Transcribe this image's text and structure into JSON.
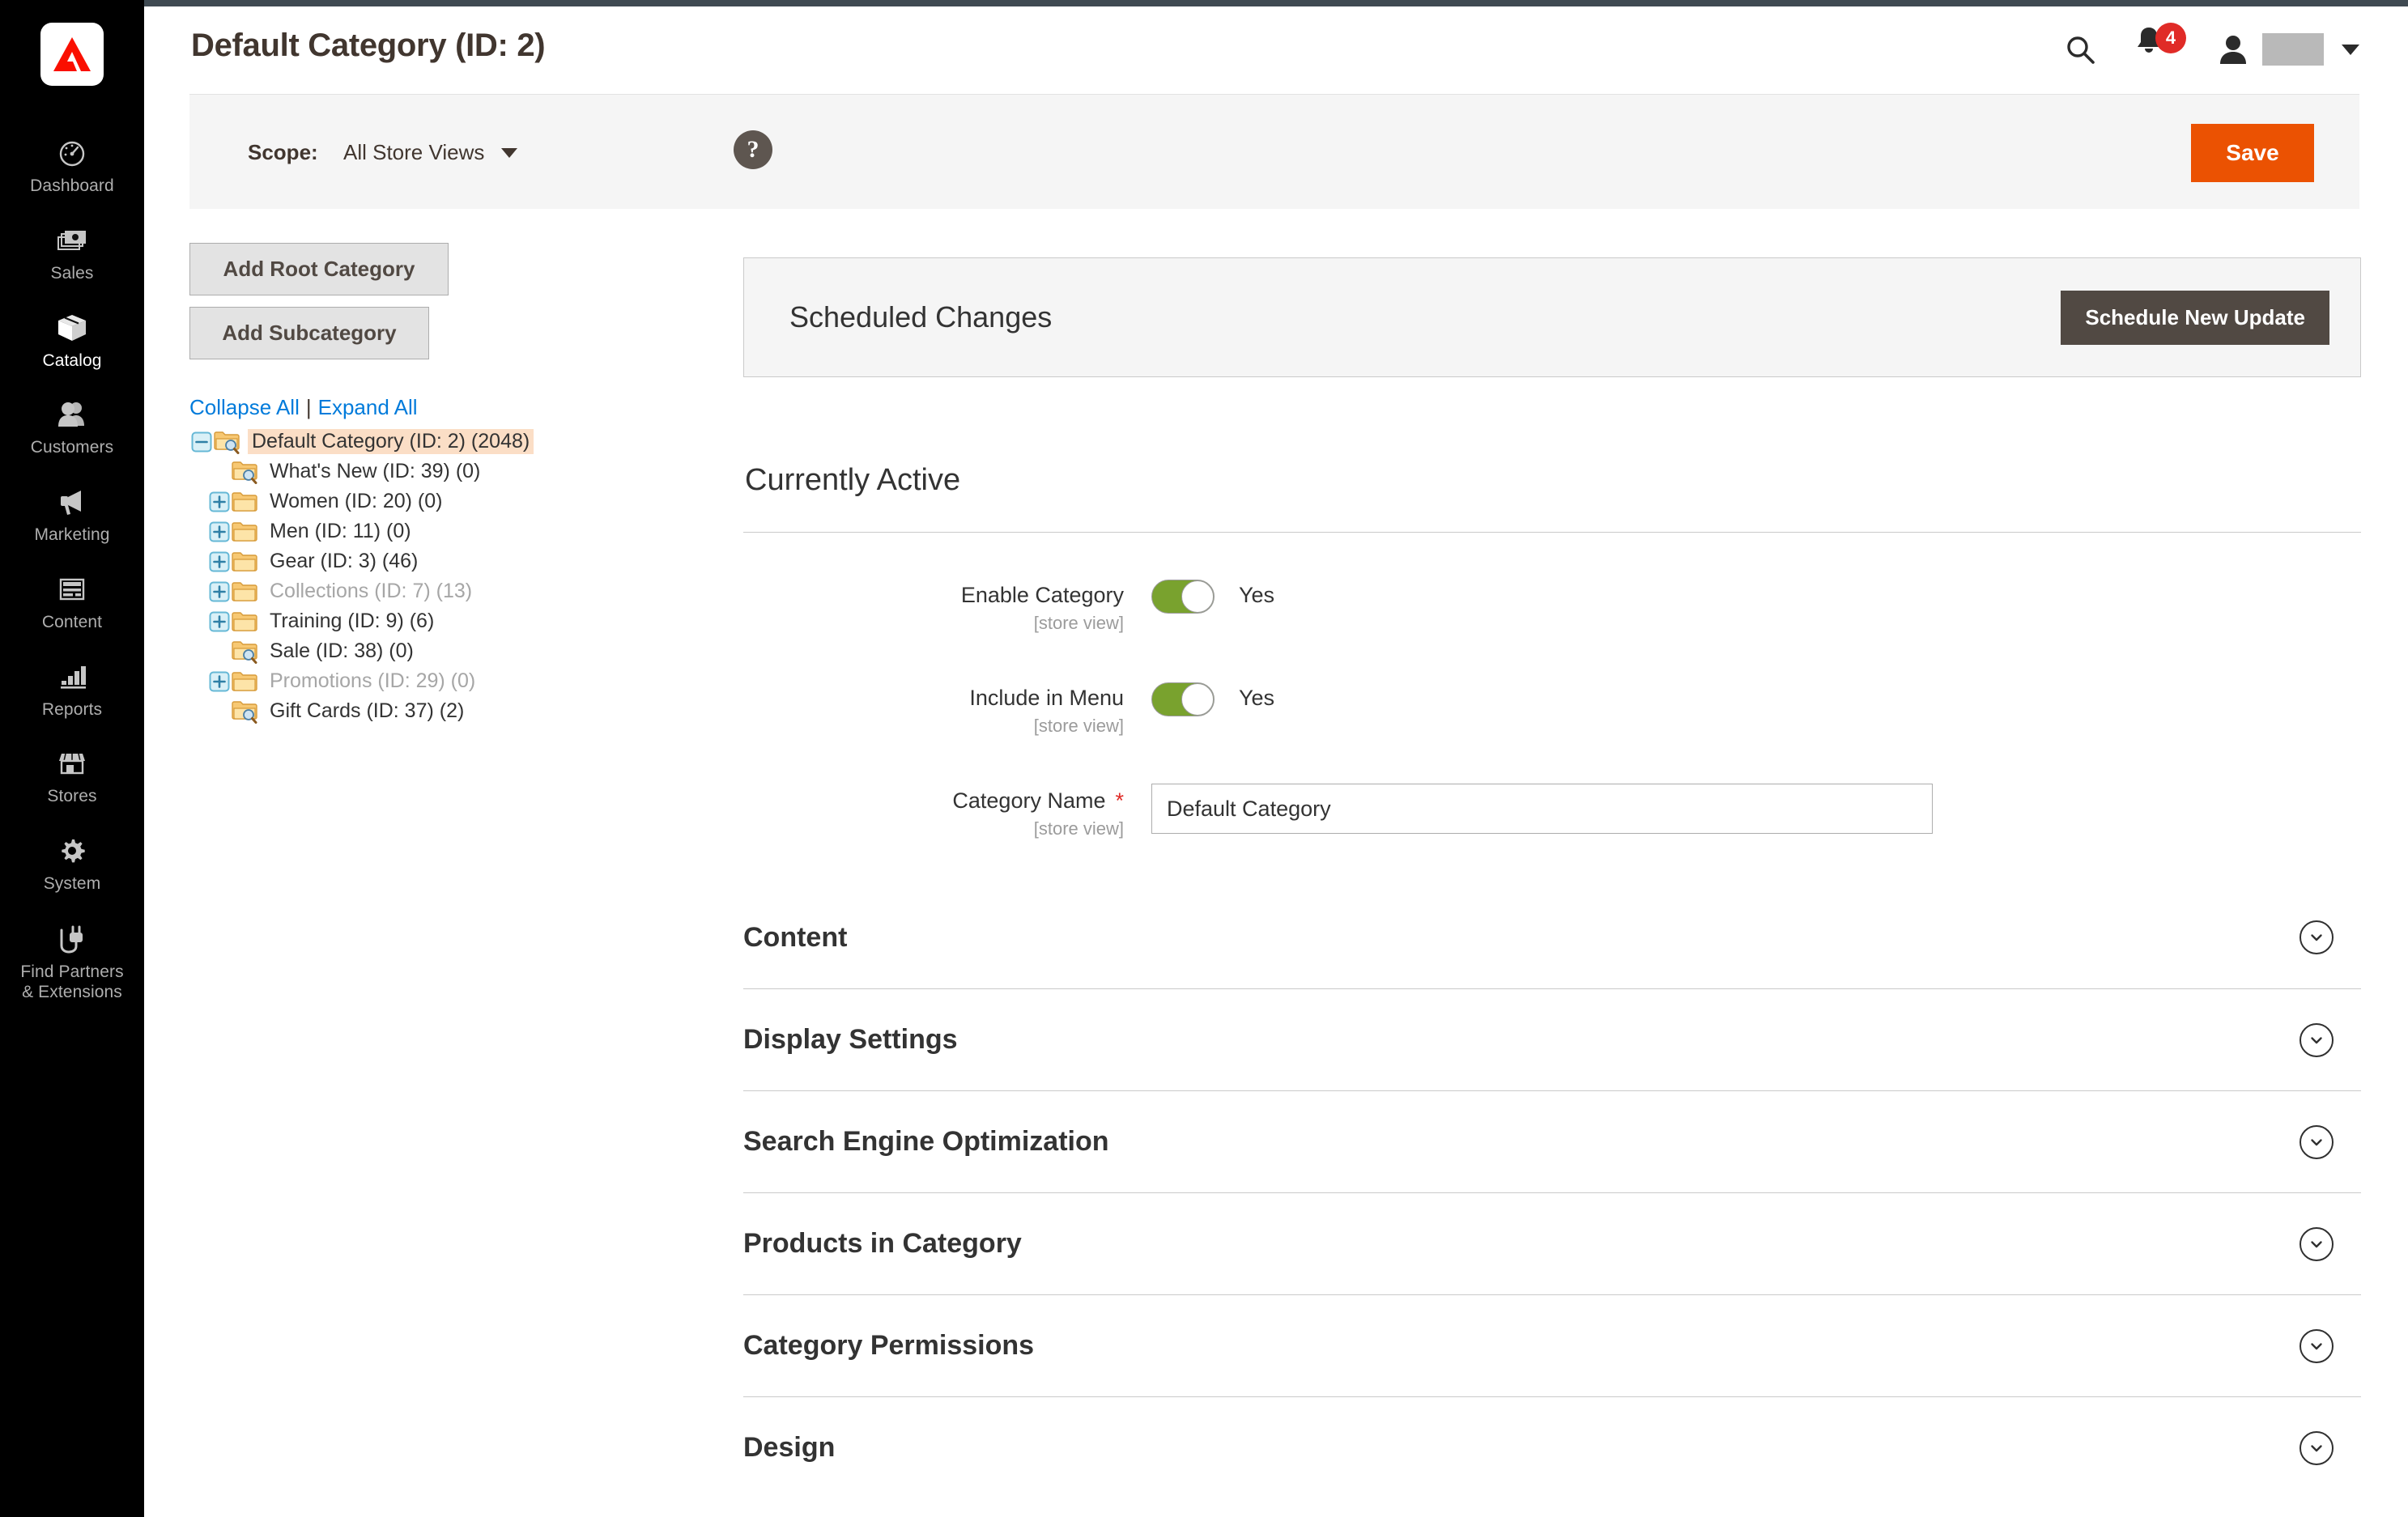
{
  "app": {
    "logo_icon": "adobe-logo-icon",
    "brand_color": "#fa0f00"
  },
  "sidebar": {
    "items": [
      {
        "label": "Dashboard",
        "icon": "dashboard-gauge-icon",
        "active": false
      },
      {
        "label": "Sales",
        "icon": "sales-money-icon",
        "active": false
      },
      {
        "label": "Catalog",
        "icon": "catalog-box-icon",
        "active": true
      },
      {
        "label": "Customers",
        "icon": "customers-people-icon",
        "active": false
      },
      {
        "label": "Marketing",
        "icon": "marketing-megaphone-icon",
        "active": false
      },
      {
        "label": "Content",
        "icon": "content-page-icon",
        "active": false
      },
      {
        "label": "Reports",
        "icon": "reports-bars-icon",
        "active": false
      },
      {
        "label": "Stores",
        "icon": "stores-shop-icon",
        "active": false
      },
      {
        "label": "System",
        "icon": "system-gear-icon",
        "active": false
      },
      {
        "label": "Find Partners\n& Extensions",
        "label_line1": "Find Partners",
        "label_line2": "& Extensions",
        "icon": "extensions-plug-icon",
        "active": false
      }
    ]
  },
  "header": {
    "title": "Default Category (ID: 2)",
    "search_icon": "search-icon",
    "notifications_icon": "bell-icon",
    "notifications_count": "4",
    "notifications_badge_color": "#e02b27",
    "account_icon": "user-avatar-icon",
    "account_name_redacted": "",
    "account_caret_icon": "chevron-down-icon"
  },
  "scope": {
    "label": "Scope:",
    "value": "All Store Views",
    "caret_icon": "chevron-down-icon",
    "help_icon": "question-mark-icon",
    "help_glyph": "?",
    "save_label": "Save",
    "save_color": "#eb5202"
  },
  "tree_panel": {
    "add_root_label": "Add Root Category",
    "add_sub_label": "Add Subcategory",
    "collapse_all": "Collapse All",
    "separator": "|",
    "expand_all": "Expand All",
    "link_color": "#007bdb",
    "selected_highlight_color": "#fbdec6",
    "nodes": [
      {
        "label": "Default Category (ID: 2) (2048)",
        "level": 0,
        "twisty": "minus",
        "icon": "folder-search-icon",
        "selected": true,
        "dim": false
      },
      {
        "label": "What's New (ID: 39) (0)",
        "level": 1,
        "twisty": "none",
        "icon": "folder-search-icon",
        "selected": false,
        "dim": false
      },
      {
        "label": "Women (ID: 20) (0)",
        "level": 1,
        "twisty": "plus",
        "icon": "folder-icon",
        "selected": false,
        "dim": false
      },
      {
        "label": "Men (ID: 11) (0)",
        "level": 1,
        "twisty": "plus",
        "icon": "folder-icon",
        "selected": false,
        "dim": false
      },
      {
        "label": "Gear (ID: 3) (46)",
        "level": 1,
        "twisty": "plus",
        "icon": "folder-icon",
        "selected": false,
        "dim": false
      },
      {
        "label": "Collections (ID: 7) (13)",
        "level": 1,
        "twisty": "plus",
        "icon": "folder-icon",
        "selected": false,
        "dim": true
      },
      {
        "label": "Training (ID: 9) (6)",
        "level": 1,
        "twisty": "plus",
        "icon": "folder-icon",
        "selected": false,
        "dim": false
      },
      {
        "label": "Sale (ID: 38) (0)",
        "level": 1,
        "twisty": "none",
        "icon": "folder-search-icon",
        "selected": false,
        "dim": false
      },
      {
        "label": "Promotions (ID: 29) (0)",
        "level": 1,
        "twisty": "plus",
        "icon": "folder-icon",
        "selected": false,
        "dim": true
      },
      {
        "label": "Gift Cards (ID: 37) (2)",
        "level": 1,
        "twisty": "none",
        "icon": "folder-search-icon",
        "selected": false,
        "dim": false
      }
    ]
  },
  "scheduled_changes": {
    "title": "Scheduled Changes",
    "button_label": "Schedule New Update",
    "button_color": "#514943"
  },
  "currently_active": {
    "title": "Currently Active",
    "fields": {
      "enable_category": {
        "label": "Enable Category",
        "scope_note": "[store view]",
        "toggle_state": "Yes",
        "toggle_on_color": "#79a22e"
      },
      "include_in_menu": {
        "label": "Include in Menu",
        "scope_note": "[store view]",
        "toggle_state": "Yes",
        "toggle_on_color": "#79a22e"
      },
      "category_name": {
        "label": "Category Name",
        "required_marker": "*",
        "scope_note": "[store view]",
        "value": "Default Category",
        "placeholder": ""
      }
    }
  },
  "collapsible_sections": [
    {
      "title": "Content",
      "icon": "chevron-down-circle-icon",
      "expanded": false
    },
    {
      "title": "Display Settings",
      "icon": "chevron-down-circle-icon",
      "expanded": false
    },
    {
      "title": "Search Engine Optimization",
      "icon": "chevron-down-circle-icon",
      "expanded": false
    },
    {
      "title": "Products in Category",
      "icon": "chevron-down-circle-icon",
      "expanded": false
    },
    {
      "title": "Category Permissions",
      "icon": "chevron-down-circle-icon",
      "expanded": false
    },
    {
      "title": "Design",
      "icon": "chevron-down-circle-icon",
      "expanded": false
    }
  ]
}
